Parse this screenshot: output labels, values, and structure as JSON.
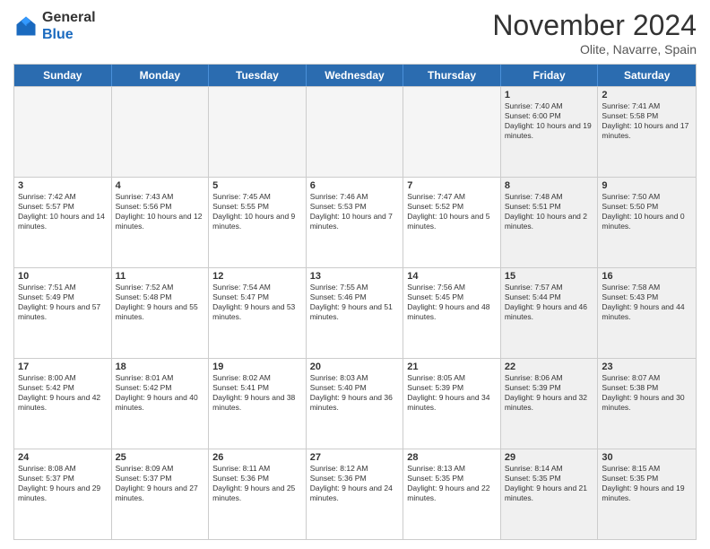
{
  "logo": {
    "general": "General",
    "blue": "Blue"
  },
  "header": {
    "month": "November 2024",
    "location": "Olite, Navarre, Spain"
  },
  "days": [
    "Sunday",
    "Monday",
    "Tuesday",
    "Wednesday",
    "Thursday",
    "Friday",
    "Saturday"
  ],
  "rows": [
    [
      {
        "day": "",
        "text": "",
        "empty": true
      },
      {
        "day": "",
        "text": "",
        "empty": true
      },
      {
        "day": "",
        "text": "",
        "empty": true
      },
      {
        "day": "",
        "text": "",
        "empty": true
      },
      {
        "day": "",
        "text": "",
        "empty": true
      },
      {
        "day": "1",
        "text": "Sunrise: 7:40 AM\nSunset: 6:00 PM\nDaylight: 10 hours and 19 minutes.",
        "shaded": true
      },
      {
        "day": "2",
        "text": "Sunrise: 7:41 AM\nSunset: 5:58 PM\nDaylight: 10 hours and 17 minutes.",
        "shaded": true
      }
    ],
    [
      {
        "day": "3",
        "text": "Sunrise: 7:42 AM\nSunset: 5:57 PM\nDaylight: 10 hours and 14 minutes."
      },
      {
        "day": "4",
        "text": "Sunrise: 7:43 AM\nSunset: 5:56 PM\nDaylight: 10 hours and 12 minutes."
      },
      {
        "day": "5",
        "text": "Sunrise: 7:45 AM\nSunset: 5:55 PM\nDaylight: 10 hours and 9 minutes."
      },
      {
        "day": "6",
        "text": "Sunrise: 7:46 AM\nSunset: 5:53 PM\nDaylight: 10 hours and 7 minutes."
      },
      {
        "day": "7",
        "text": "Sunrise: 7:47 AM\nSunset: 5:52 PM\nDaylight: 10 hours and 5 minutes."
      },
      {
        "day": "8",
        "text": "Sunrise: 7:48 AM\nSunset: 5:51 PM\nDaylight: 10 hours and 2 minutes.",
        "shaded": true
      },
      {
        "day": "9",
        "text": "Sunrise: 7:50 AM\nSunset: 5:50 PM\nDaylight: 10 hours and 0 minutes.",
        "shaded": true
      }
    ],
    [
      {
        "day": "10",
        "text": "Sunrise: 7:51 AM\nSunset: 5:49 PM\nDaylight: 9 hours and 57 minutes."
      },
      {
        "day": "11",
        "text": "Sunrise: 7:52 AM\nSunset: 5:48 PM\nDaylight: 9 hours and 55 minutes."
      },
      {
        "day": "12",
        "text": "Sunrise: 7:54 AM\nSunset: 5:47 PM\nDaylight: 9 hours and 53 minutes."
      },
      {
        "day": "13",
        "text": "Sunrise: 7:55 AM\nSunset: 5:46 PM\nDaylight: 9 hours and 51 minutes."
      },
      {
        "day": "14",
        "text": "Sunrise: 7:56 AM\nSunset: 5:45 PM\nDaylight: 9 hours and 48 minutes."
      },
      {
        "day": "15",
        "text": "Sunrise: 7:57 AM\nSunset: 5:44 PM\nDaylight: 9 hours and 46 minutes.",
        "shaded": true
      },
      {
        "day": "16",
        "text": "Sunrise: 7:58 AM\nSunset: 5:43 PM\nDaylight: 9 hours and 44 minutes.",
        "shaded": true
      }
    ],
    [
      {
        "day": "17",
        "text": "Sunrise: 8:00 AM\nSunset: 5:42 PM\nDaylight: 9 hours and 42 minutes."
      },
      {
        "day": "18",
        "text": "Sunrise: 8:01 AM\nSunset: 5:42 PM\nDaylight: 9 hours and 40 minutes."
      },
      {
        "day": "19",
        "text": "Sunrise: 8:02 AM\nSunset: 5:41 PM\nDaylight: 9 hours and 38 minutes."
      },
      {
        "day": "20",
        "text": "Sunrise: 8:03 AM\nSunset: 5:40 PM\nDaylight: 9 hours and 36 minutes."
      },
      {
        "day": "21",
        "text": "Sunrise: 8:05 AM\nSunset: 5:39 PM\nDaylight: 9 hours and 34 minutes."
      },
      {
        "day": "22",
        "text": "Sunrise: 8:06 AM\nSunset: 5:39 PM\nDaylight: 9 hours and 32 minutes.",
        "shaded": true
      },
      {
        "day": "23",
        "text": "Sunrise: 8:07 AM\nSunset: 5:38 PM\nDaylight: 9 hours and 30 minutes.",
        "shaded": true
      }
    ],
    [
      {
        "day": "24",
        "text": "Sunrise: 8:08 AM\nSunset: 5:37 PM\nDaylight: 9 hours and 29 minutes."
      },
      {
        "day": "25",
        "text": "Sunrise: 8:09 AM\nSunset: 5:37 PM\nDaylight: 9 hours and 27 minutes."
      },
      {
        "day": "26",
        "text": "Sunrise: 8:11 AM\nSunset: 5:36 PM\nDaylight: 9 hours and 25 minutes."
      },
      {
        "day": "27",
        "text": "Sunrise: 8:12 AM\nSunset: 5:36 PM\nDaylight: 9 hours and 24 minutes."
      },
      {
        "day": "28",
        "text": "Sunrise: 8:13 AM\nSunset: 5:35 PM\nDaylight: 9 hours and 22 minutes."
      },
      {
        "day": "29",
        "text": "Sunrise: 8:14 AM\nSunset: 5:35 PM\nDaylight: 9 hours and 21 minutes.",
        "shaded": true
      },
      {
        "day": "30",
        "text": "Sunrise: 8:15 AM\nSunset: 5:35 PM\nDaylight: 9 hours and 19 minutes.",
        "shaded": true
      }
    ]
  ]
}
